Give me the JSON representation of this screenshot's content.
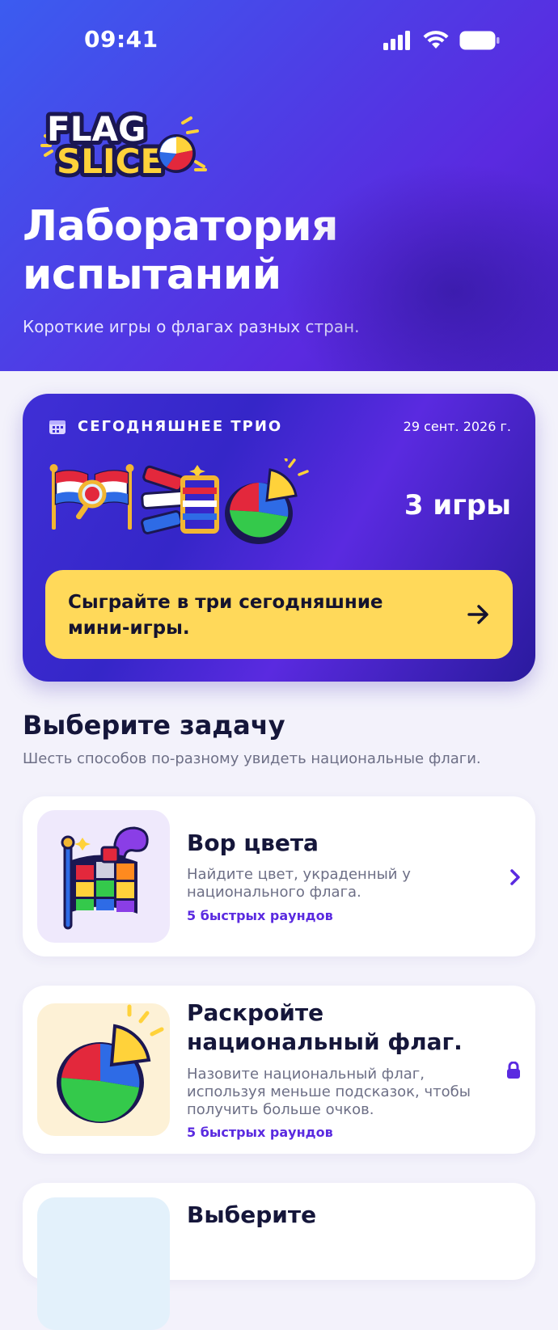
{
  "status_bar": {
    "time": "09:41"
  },
  "header": {
    "logo_text_top": "FLAG",
    "logo_text_bottom": "SLICE",
    "title": "Лаборатория испытаний",
    "subtitle": "Короткие игры о флагах разных стран."
  },
  "trio": {
    "label": "СЕГОДНЯШНЕЕ ТРИО",
    "date": "29 сент. 2026 г.",
    "count": "3 игры",
    "cta": "Сыграйте в три сегодняшние мини-игры."
  },
  "section": {
    "title": "Выберите задачу",
    "subtitle": "Шесть способов по-разному увидеть национальные флаги."
  },
  "games": [
    {
      "title": "Вор цвета",
      "description": "Найдите цвет, украденный у национального флага.",
      "meta": "5 быстрых раундов",
      "status": "chevron-right-icon",
      "thumb_color": "#efe9fc"
    },
    {
      "title": "Раскройте национальный флаг.",
      "description": "Назовите национальный флаг, используя меньше подсказок, чтобы получить больше очков.",
      "meta": "5 быстрых раундов",
      "status": "lock-icon",
      "thumb_color": "#fdf1d6"
    },
    {
      "title": "Выберите",
      "thumb_color": "#e3f1fb"
    }
  ],
  "colors": {
    "accent": "#5a2ae0",
    "cta": "#ffd95a",
    "background": "#f3f2fb",
    "text_dark": "#15163a"
  }
}
